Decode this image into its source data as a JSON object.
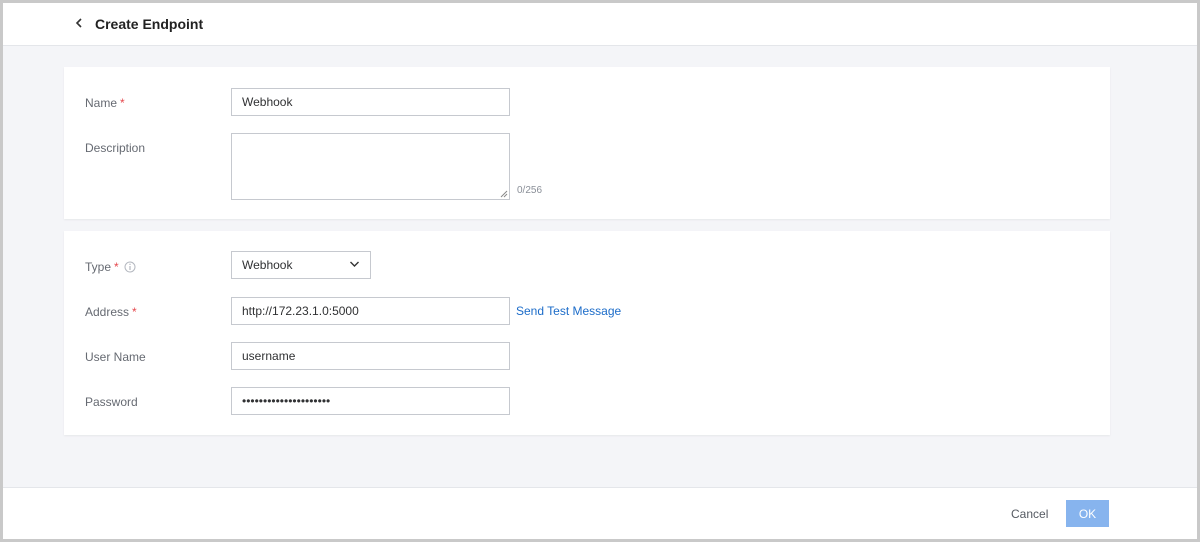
{
  "header": {
    "title": "Create Endpoint",
    "back_icon": "chevron-left-icon"
  },
  "general": {
    "name": {
      "label": "Name",
      "required_mark": "*",
      "value": "Webhook"
    },
    "description": {
      "label": "Description",
      "value": "",
      "counter": "0/256"
    }
  },
  "connection": {
    "type": {
      "label": "Type",
      "required_mark": "*",
      "info_icon": "info-icon",
      "value": "Webhook"
    },
    "address": {
      "label": "Address",
      "required_mark": "*",
      "value": "http://172.23.1.0:5000",
      "action_link": "Send Test Message"
    },
    "username": {
      "label": "User Name",
      "value": "username"
    },
    "password": {
      "label": "Password",
      "value": "•••••••••••••••••••••"
    }
  },
  "footer": {
    "cancel_label": "Cancel",
    "ok_label": "OK"
  },
  "colors": {
    "accent_link": "#1c6cc9",
    "ok_button_disabled": "#87b4ee",
    "required": "#e5484d",
    "page_background": "#f4f5f8"
  }
}
